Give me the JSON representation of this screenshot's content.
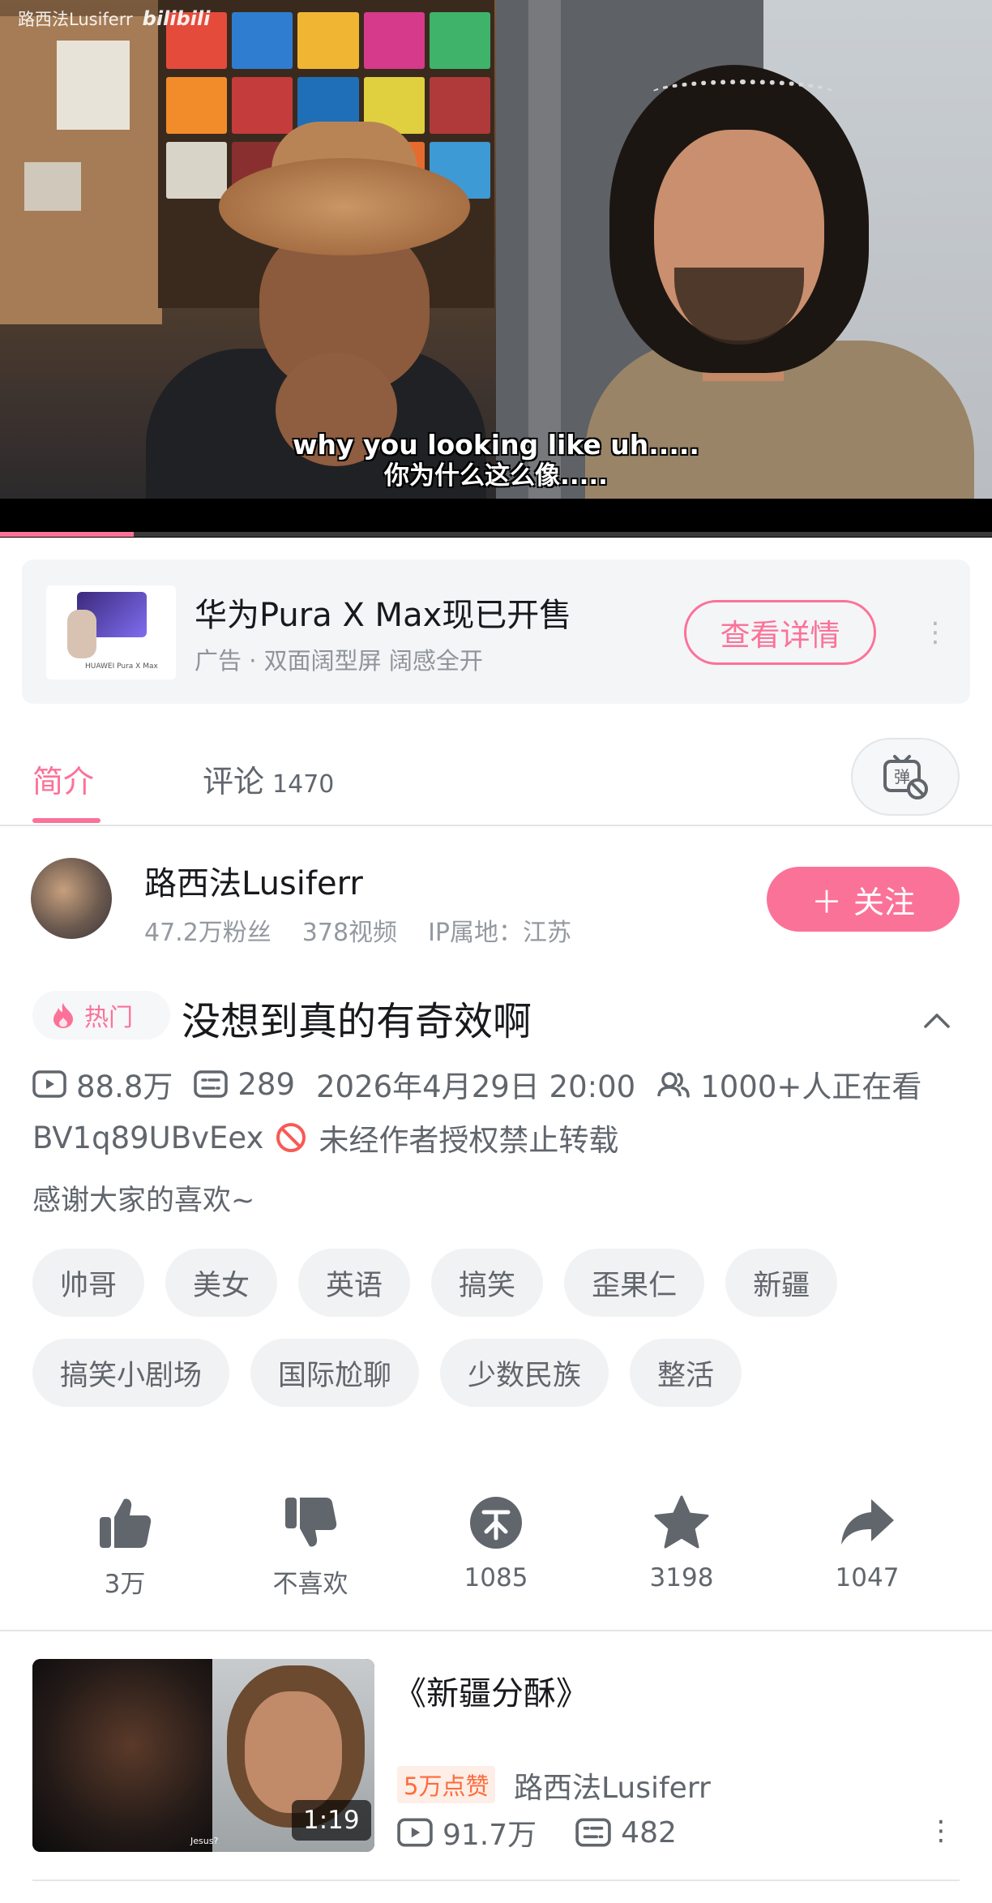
{
  "video": {
    "watermark_author": "路西法Lusiferr",
    "watermark_logo": "bilibili",
    "subtitle_en": "why you looking like uh.....",
    "subtitle_zh": "你为什么这么像.....",
    "progress_fraction": 0.135,
    "accent_color": "#fb7299"
  },
  "ad": {
    "thumb_caption": "HUAWEI Pura X Max",
    "title": "华为Pura X Max现已开售",
    "subtitle": "广告 · 双面阔型屏 阔感全开",
    "button_label": "查看详情",
    "more_icon": "⋮"
  },
  "tabs": {
    "intro": "简介",
    "comments": "评论",
    "comments_count": "1470",
    "danmaku_icon": "danmaku-off-icon"
  },
  "uploader": {
    "name": "路西法Lusiferr",
    "fans": "47.2万粉丝",
    "videos": "378视频",
    "ip": "IP属地：江苏",
    "follow_label": "关注",
    "follow_plus": "＋"
  },
  "info": {
    "hot_label": "热门",
    "title": "没想到真的有奇效啊",
    "views": "88.8万",
    "danmaku_count": "289",
    "date": "2026年4月29日 20:00",
    "watching": "1000+人正在看",
    "bvid": "BV1q89UBvEex",
    "copyright": "未经作者授权禁止转载",
    "description": "感谢大家的喜欢~"
  },
  "tags": [
    "帅哥",
    "美女",
    "英语",
    "搞笑",
    "歪果仁",
    "新疆",
    "搞笑小剧场",
    "国际尬聊",
    "少数民族",
    "整活"
  ],
  "actions": {
    "like": "3万",
    "dislike": "不喜欢",
    "coin": "1085",
    "favorite": "3198",
    "share": "1047"
  },
  "related": {
    "title": "《新疆分酥》",
    "duration": "1:19",
    "badge": "5万点赞",
    "author": "路西法Lusiferr",
    "views": "91.7万",
    "danmaku_count": "482",
    "thumb_caption": "Jesus?",
    "more_icon": "⋮"
  }
}
